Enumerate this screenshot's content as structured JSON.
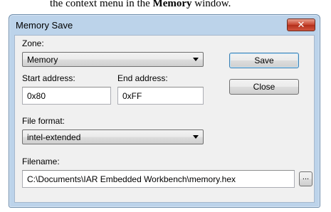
{
  "caption": {
    "prefix": "the context menu in the ",
    "bold": "Memory",
    "suffix": " window."
  },
  "dialog": {
    "title": "Memory Save",
    "close_glyph": "✕"
  },
  "zone": {
    "label": "Zone:",
    "value": "Memory"
  },
  "start_address": {
    "label": "Start address:",
    "value": "0x80"
  },
  "end_address": {
    "label": "End address:",
    "value": "0xFF"
  },
  "file_format": {
    "label": "File format:",
    "value": "intel-extended"
  },
  "filename": {
    "label": "Filename:",
    "value": "C:\\Documents\\IAR Embedded Workbench\\memory.hex",
    "browse_label": "..."
  },
  "buttons": {
    "save": "Save",
    "close": "Close"
  }
}
